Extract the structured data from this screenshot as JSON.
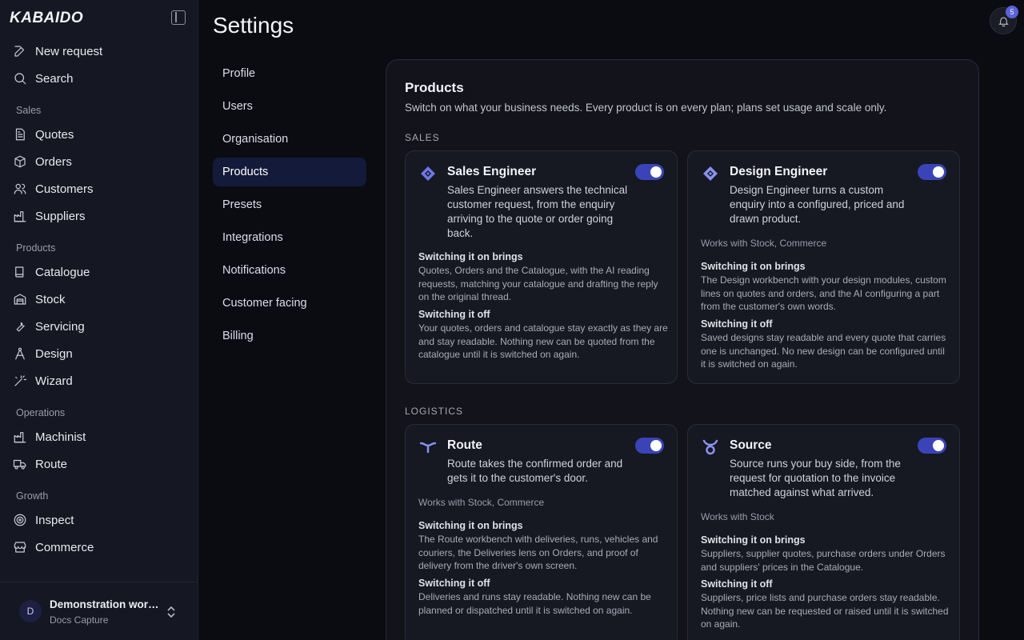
{
  "app": {
    "logo": "KABAIDO"
  },
  "sidebar": {
    "top_items": [
      {
        "label": "New request",
        "icon": "edit-icon"
      },
      {
        "label": "Search",
        "icon": "search-icon"
      }
    ],
    "sections": [
      {
        "label": "Sales",
        "items": [
          {
            "label": "Quotes",
            "icon": "document-icon"
          },
          {
            "label": "Orders",
            "icon": "box-icon"
          },
          {
            "label": "Customers",
            "icon": "users-icon"
          },
          {
            "label": "Suppliers",
            "icon": "factory-icon"
          }
        ]
      },
      {
        "label": "Products",
        "items": [
          {
            "label": "Catalogue",
            "icon": "book-icon"
          },
          {
            "label": "Stock",
            "icon": "warehouse-icon"
          },
          {
            "label": "Servicing",
            "icon": "wrench-icon"
          },
          {
            "label": "Design",
            "icon": "compass-icon"
          },
          {
            "label": "Wizard",
            "icon": "wand-icon"
          }
        ]
      },
      {
        "label": "Operations",
        "items": [
          {
            "label": "Machinist",
            "icon": "factory-icon"
          },
          {
            "label": "Route",
            "icon": "truck-icon"
          }
        ]
      },
      {
        "label": "Growth",
        "items": [
          {
            "label": "Inspect",
            "icon": "target-icon"
          },
          {
            "label": "Commerce",
            "icon": "store-icon"
          }
        ]
      }
    ],
    "workspace": {
      "avatar": "D",
      "name": "Demonstration work...",
      "sub": "Docs Capture"
    }
  },
  "header": {
    "title": "Settings",
    "notifications": "5"
  },
  "settings_nav": [
    {
      "label": "Profile",
      "active": false
    },
    {
      "label": "Users",
      "active": false
    },
    {
      "label": "Organisation",
      "active": false
    },
    {
      "label": "Products",
      "active": true
    },
    {
      "label": "Presets",
      "active": false
    },
    {
      "label": "Integrations",
      "active": false
    },
    {
      "label": "Notifications",
      "active": false
    },
    {
      "label": "Customer facing",
      "active": false
    },
    {
      "label": "Billing",
      "active": false
    }
  ],
  "panel": {
    "title": "Products",
    "description": "Switch on what your business needs. Every product is on every plan; plans set usage and scale only.",
    "groups": [
      {
        "label": "SALES"
      },
      {
        "label": "LOGISTICS"
      }
    ],
    "cards": [
      {
        "title": "Sales Engineer",
        "enabled": true,
        "description": "Sales Engineer answers the technical customer request, from the enquiry arriving to the quote or order going back.",
        "works_with": "",
        "on_heading": "Switching it on brings",
        "on_text": "Quotes, Orders and the Catalogue, with the AI reading requests, matching your catalogue and drafting the reply on the original thread.",
        "off_heading": "Switching it off",
        "off_text": "Your quotes, orders and catalogue stay exactly as they are and stay readable. Nothing new can be quoted from the catalogue until it is switched on again."
      },
      {
        "title": "Design Engineer",
        "enabled": true,
        "description": "Design Engineer turns a custom enquiry into a configured, priced and drawn product.",
        "works_with": "Works with Stock, Commerce",
        "on_heading": "Switching it on brings",
        "on_text": "The Design workbench with your design modules, custom lines on quotes and orders, and the AI configuring a part from the customer's own words.",
        "off_heading": "Switching it off",
        "off_text": "Saved designs stay readable and every quote that carries one is unchanged. No new design can be configured until it is switched on again."
      },
      {
        "title": "Route",
        "enabled": true,
        "description": "Route takes the confirmed order and gets it to the customer's door.",
        "works_with": "Works with Stock, Commerce",
        "on_heading": "Switching it on brings",
        "on_text": "The Route workbench with deliveries, runs, vehicles and couriers, the Deliveries lens on Orders, and proof of delivery from the driver's own screen.",
        "off_heading": "Switching it off",
        "off_text": "Deliveries and runs stay readable. Nothing new can be planned or dispatched until it is switched on again."
      },
      {
        "title": "Source",
        "enabled": true,
        "description": "Source runs your buy side, from the request for quotation to the invoice matched against what arrived.",
        "works_with": "Works with Stock",
        "on_heading": "Switching it on brings",
        "on_text": "Suppliers, supplier quotes, purchase orders under Orders and suppliers' prices in the Catalogue.",
        "off_heading": "Switching it off",
        "off_text": "Suppliers, price lists and purchase orders stay readable. Nothing new can be requested or raised until it is switched on again."
      }
    ]
  },
  "colors": {
    "accent": "#3a44b8",
    "active_nav": "#141a3a",
    "badge": "#5b62d8"
  }
}
